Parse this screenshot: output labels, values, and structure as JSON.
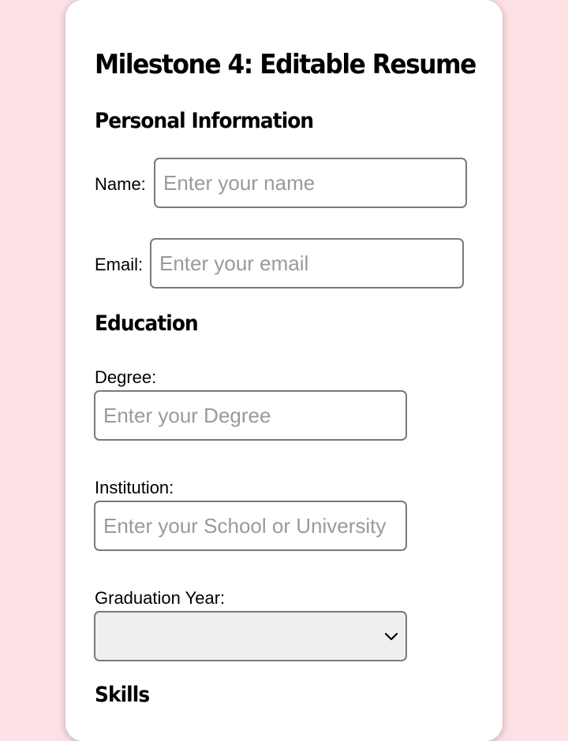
{
  "page": {
    "title": "Milestone 4: Editable Resume"
  },
  "sections": {
    "personal": "Personal Information",
    "education": "Education",
    "skills": "Skills"
  },
  "fields": {
    "name": {
      "label": "Name:",
      "placeholder": "Enter your name",
      "value": ""
    },
    "email": {
      "label": "Email:",
      "placeholder": "Enter your email",
      "value": ""
    },
    "degree": {
      "label": "Degree:",
      "placeholder": "Enter your Degree",
      "value": ""
    },
    "institution": {
      "label": "Institution:",
      "placeholder": "Enter your School or University",
      "value": ""
    },
    "graduation_year": {
      "label": "Graduation Year:",
      "selected": ""
    }
  },
  "colors": {
    "background": "#fde1e5",
    "card": "#ffffff",
    "border": "#7a7a7a",
    "placeholder": "#9a9a9a"
  },
  "icons": {
    "select_arrow": "chevron-down-icon"
  }
}
